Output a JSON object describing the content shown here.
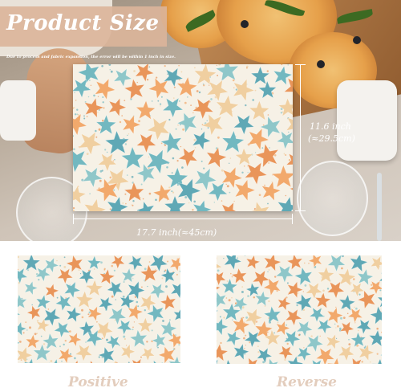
{
  "header": {
    "title": "Product Size",
    "note": "Due to process and fabric expansion, the error will be within 1 inch in size."
  },
  "dimensions": {
    "width_label": "17.7 inch(≈45cm)",
    "height_label_inch": "11.6 inch",
    "height_label_cm": "(≈29.5cm)"
  },
  "captions": {
    "positive": "Positive",
    "reverse": "Reverse"
  },
  "colors": {
    "mat_bg": "#f6f1e6",
    "starfish_teal": "#72b8c0",
    "starfish_orange": "#e9955a",
    "starfish_sand": "#f0cfa0",
    "caption": "#e3cdbd",
    "badge": "#dcb59a"
  },
  "pattern": {
    "motif": "starfish-icon",
    "palette": [
      "#72b8c0",
      "#e9955a",
      "#f0cfa0",
      "#8fc7c9",
      "#f2a96c",
      "#5fa8b5"
    ]
  }
}
